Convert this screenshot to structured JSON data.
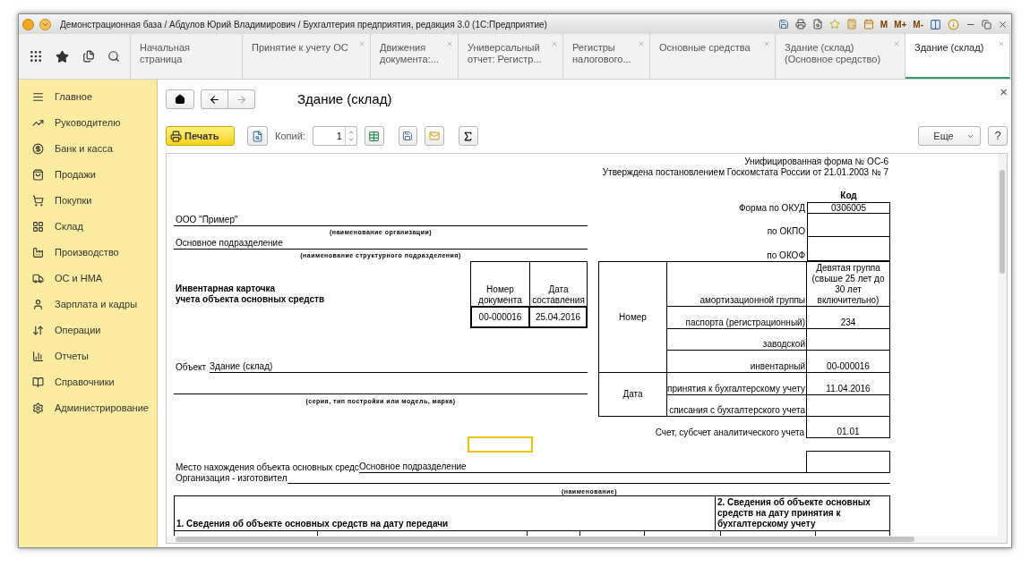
{
  "window": {
    "title": "Демонстрационная база / Абдулов Юрий Владимирович / Бухгалтерия предприятия, редакция 3.0  (1С:Предприятие)",
    "memory_buttons": [
      "M",
      "M+",
      "M-"
    ]
  },
  "tabs": [
    {
      "label": "Начальная страница",
      "selected": false,
      "closable": false
    },
    {
      "label": "Принятие к учету ОС",
      "selected": false,
      "closable": true
    },
    {
      "label": "Движения документа:...",
      "selected": false,
      "closable": true
    },
    {
      "label": "Универсальный отчет: Регистр...",
      "selected": false,
      "closable": true
    },
    {
      "label": "Регистры налогового...",
      "selected": false,
      "closable": true
    },
    {
      "label": "Основные средства",
      "selected": false,
      "closable": true
    },
    {
      "label": "Здание (склад) (Основное средство)",
      "selected": false,
      "closable": true
    },
    {
      "label": "Здание (склад)",
      "selected": true,
      "closable": true
    }
  ],
  "sidebar": {
    "items": [
      {
        "label": "Главное"
      },
      {
        "label": "Руководителю"
      },
      {
        "label": "Банк и касса"
      },
      {
        "label": "Продажи"
      },
      {
        "label": "Покупки"
      },
      {
        "label": "Склад"
      },
      {
        "label": "Производство"
      },
      {
        "label": "ОС и НМА"
      },
      {
        "label": "Зарплата и кадры"
      },
      {
        "label": "Операции"
      },
      {
        "label": "Отчеты"
      },
      {
        "label": "Справочники"
      },
      {
        "label": "Администрирование"
      }
    ]
  },
  "form": {
    "title": "Здание (склад)",
    "close": "×"
  },
  "toolbar": {
    "print_button": "Печать",
    "copies_label": "Копий:",
    "copies_value": "1",
    "more_button": "Еще",
    "help_button": "?"
  },
  "document": {
    "form_name": "Унифицированная форма № ОС-6",
    "approval": "Утверждена постановлением Госкомстата России от 21.01.2003 № 7",
    "code_header": "Код",
    "codes": [
      {
        "label": "Форма по ОКУД",
        "value": "0306005"
      },
      {
        "label": "по ОКПО"
      },
      {
        "label": "по ОКОФ"
      }
    ],
    "organization": "ООО \"Пример\"",
    "organization_caption": "(наименование организации)",
    "department": "Основное подразделение",
    "department_caption": "(наименование структурного подразделения)",
    "card_title": [
      "Инвентарная карточка",
      "учета объекта основных средств"
    ],
    "doc_table": {
      "number_header": "Номер документа",
      "date_header": "Дата составления",
      "number": "00-000016",
      "date": "25.04.2016"
    },
    "id_table": {
      "number_label": "Номер",
      "date_label": "Дата",
      "number_rows": [
        {
          "label": "амортизационной группы",
          "value": "Девятая группа (свыше 25 лет до 30 лет включительно)"
        },
        {
          "label": "паспорта (регистрационный)",
          "value": "234"
        },
        {
          "label": "заводской"
        },
        {
          "label": "инвентарный",
          "value": "00-000016"
        }
      ],
      "date_rows": [
        {
          "label": "принятия к бухгалтерскому учету",
          "value": "11.04.2016"
        },
        {
          "label": "списания с бухгалтерского учета"
        }
      ]
    },
    "account": {
      "label": "Счет, субсчет аналитического учета",
      "value": "01.01"
    },
    "object_label": "Объект",
    "object_value": "Здание (склад)",
    "model_caption": "(серия, тип постройки или модель, марка)",
    "location_label": "Место нахождения объекта основных средс",
    "location_value": "Основное подразделение",
    "manufacturer_label": "Организация - изготовител",
    "manufacturer_caption": "(наименование)",
    "section1": "1. Сведения об объекте основных средств на дату передачи",
    "section2": "2. Сведения об объекте основных средств на дату принятия к бухгалтерскому учету"
  }
}
